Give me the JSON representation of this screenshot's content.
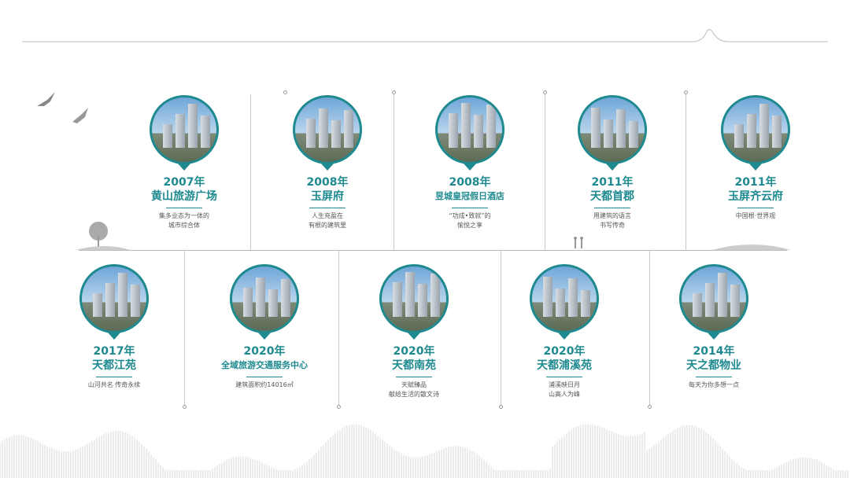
{
  "timeline_top": [
    {
      "year": "2007年",
      "name": "黄山旅游广场",
      "desc": [
        "集多业态为一体的",
        "城市综合体"
      ],
      "image": "commercial-tower-photo"
    },
    {
      "year": "2008年",
      "name": "玉屏府",
      "desc": [
        "人生充盈在",
        "有根的建筑里"
      ],
      "image": "residential-towers-photo"
    },
    {
      "year": "2008年",
      "name": "昱城皇冠假日酒店",
      "desc": [
        "“功成•致就”的",
        "愉悦之享"
      ],
      "image": "hotel-night-photo"
    },
    {
      "year": "2011年",
      "name": "天都首郡",
      "desc": [
        "用建筑的语言",
        "书写传奇"
      ],
      "image": "residential-towers-photo"
    },
    {
      "year": "2011年",
      "name": "玉屏齐云府",
      "desc": [
        "中国根·世界观"
      ],
      "image": "residential-towers-photo"
    }
  ],
  "timeline_bottom": [
    {
      "year": "2017年",
      "name": "天都江苑",
      "desc": [
        "山河共名  传奇永续"
      ],
      "image": "highrise-photo"
    },
    {
      "year": "2020年",
      "name": "全域旅游交通服务中心",
      "desc": [
        "建筑面积约14016㎡"
      ],
      "image": "transport-center-photo"
    },
    {
      "year": "2020年",
      "name": "天都南苑",
      "desc": [
        "天赋臻品",
        "献给生活的散文诗"
      ],
      "image": "residential-towers-photo"
    },
    {
      "year": "2020年",
      "name": "天都浦溪苑",
      "desc": [
        "浦溪映日月",
        "山高人为峰"
      ],
      "image": "riverside-city-photo"
    },
    {
      "year": "2014年",
      "name": "天之都物业",
      "desc": [
        "每天为你多想一点"
      ],
      "image": "deer-mascot-photo"
    }
  ],
  "colors": {
    "accent": "#1e8a8f",
    "line": "#c8c8c8"
  }
}
